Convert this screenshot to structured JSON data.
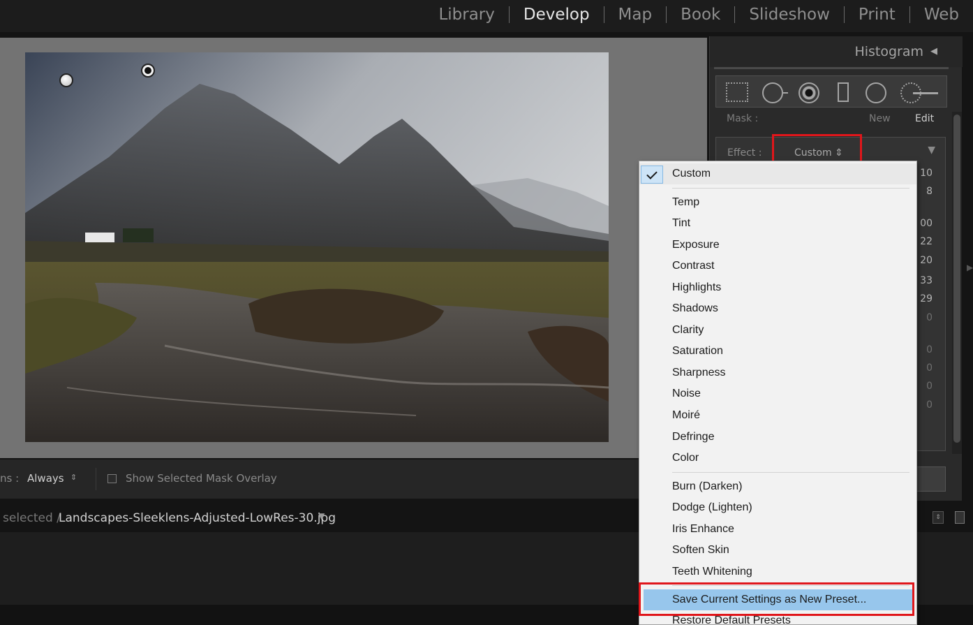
{
  "modules": [
    "Library",
    "Develop",
    "Map",
    "Book",
    "Slideshow",
    "Print",
    "Web"
  ],
  "active_module": "Develop",
  "panel": {
    "title": "Histogram",
    "mask_label": "Mask :",
    "mask_new": "New",
    "mask_edit": "Edit",
    "effect_label": "Effect :",
    "effect_value": "Custom"
  },
  "slider_values": [
    "10",
    "8",
    "00",
    "22",
    "20",
    "33",
    "29",
    "0",
    "0",
    "0",
    "0",
    "0"
  ],
  "toolbar": {
    "pins_label": "ns :",
    "pins_value": "Always",
    "overlay_label": "Show Selected Mask Overlay"
  },
  "filmstrip": {
    "selected_label": "selected /",
    "filename": "Landscapes-Sleeklens-Adjusted-LowRes-30.jpg"
  },
  "menu": {
    "checked": "Custom",
    "group1": [
      "Temp",
      "Tint",
      "Exposure",
      "Contrast",
      "Highlights",
      "Shadows",
      "Clarity",
      "Saturation",
      "Sharpness",
      "Noise",
      "Moiré",
      "Defringe",
      "Color"
    ],
    "group2": [
      "Burn (Darken)",
      "Dodge (Lighten)",
      "Iris Enhance",
      "Soften Skin",
      "Teeth Whitening"
    ],
    "save_preset": "Save Current Settings as New Preset...",
    "restore_presets": "Restore Default Presets"
  },
  "colors": {
    "highlight_box": "#e0161b",
    "menu_highlight": "#97c6ec"
  }
}
